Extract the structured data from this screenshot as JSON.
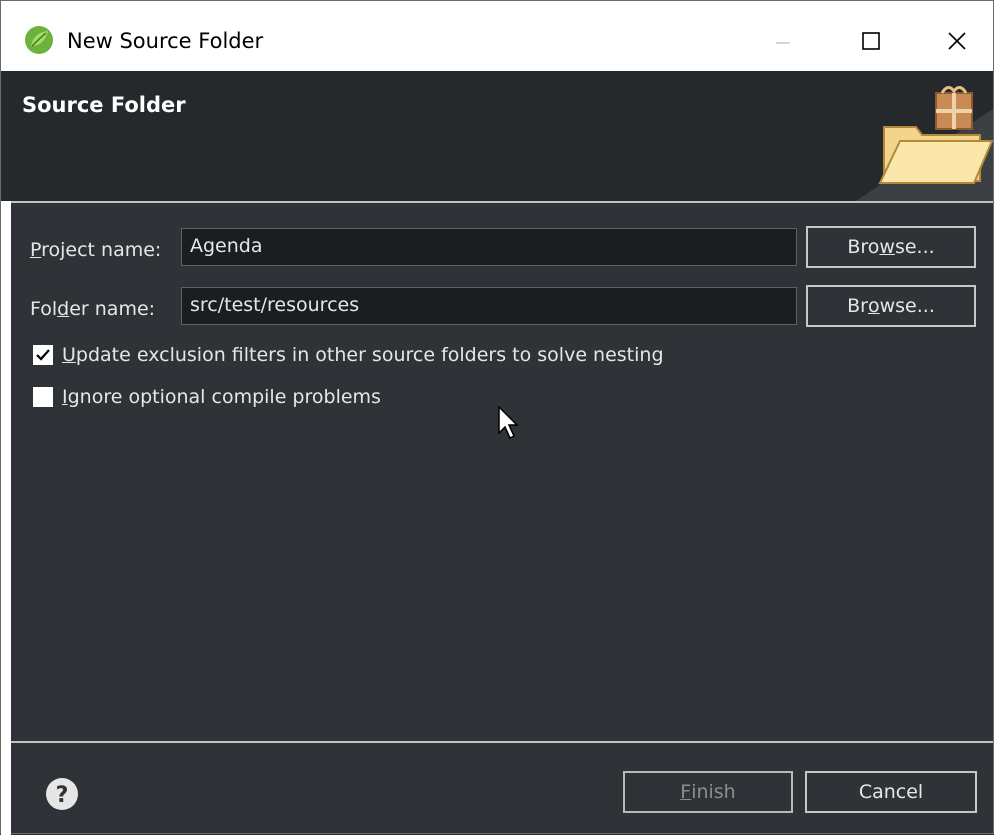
{
  "window": {
    "title": "New Source Folder"
  },
  "banner": {
    "title": "Source Folder"
  },
  "form": {
    "project": {
      "label_pre": "",
      "label_key": "P",
      "label_post": "roject name:",
      "value": "Agenda",
      "browse_pre": "Bro",
      "browse_key": "w",
      "browse_post": "se..."
    },
    "folder": {
      "label_pre": "Fol",
      "label_key": "d",
      "label_post": "er name:",
      "value": "src/test/resources",
      "browse_pre": "Br",
      "browse_key": "o",
      "browse_post": "wse..."
    },
    "update_exclusion": {
      "label_pre": "",
      "label_key": "U",
      "label_post": "pdate exclusion filters in other source folders to solve nesting",
      "checked": true
    },
    "ignore_optional": {
      "label_pre": "",
      "label_key": "I",
      "label_post": "gnore optional compile problems",
      "checked": false
    }
  },
  "footer": {
    "finish_key": "F",
    "finish_post": "inish",
    "cancel_label": "Cancel"
  },
  "icons": {
    "app": "spring-leaf-icon",
    "minimize": "minimize-icon",
    "maximize": "maximize-icon",
    "close": "close-icon",
    "banner": "folder-package-icon",
    "help": "help-icon",
    "check": "check-icon",
    "cursor": "mouse-pointer-icon"
  },
  "colors": {
    "dialog_bg": "#2f3337",
    "banner_bg": "#25292c",
    "field_bg": "#1b1e21",
    "text": "#e6e6e6",
    "app_icon": "#6bb33a"
  }
}
